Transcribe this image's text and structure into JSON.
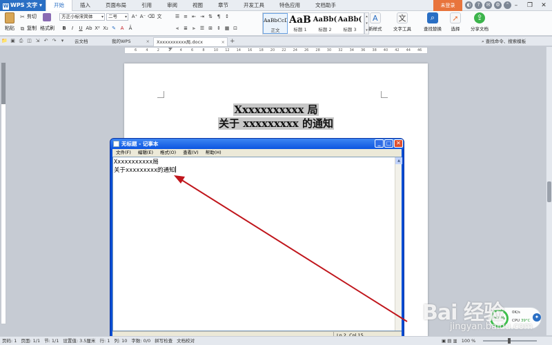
{
  "app": {
    "name": "WPS 文字"
  },
  "menu": [
    "开始",
    "插入",
    "页面布局",
    "引用",
    "审阅",
    "视图",
    "章节",
    "开发工具",
    "特色应用",
    "文档助手"
  ],
  "login_label": "未登录",
  "ribbon": {
    "paste": "粘贴",
    "cut": "剪切",
    "copy": "复制",
    "format_painter": "格式刷",
    "font_name": "方正小标宋简体",
    "font_size": "二号",
    "styles": [
      {
        "preview": "AaBbCcD",
        "name": "正文"
      },
      {
        "preview": "AaB",
        "name": "标题 1"
      },
      {
        "preview": "AaBb(",
        "name": "标题 2"
      },
      {
        "preview": "AaBb(",
        "name": "标题 3"
      }
    ],
    "new_style": "新样式",
    "text_tools": "文字工具",
    "find_replace": "查找替换",
    "select": "选择",
    "share_doc": "分享文档"
  },
  "tabs": [
    {
      "label": "云文档"
    },
    {
      "label": "我的WPS"
    },
    {
      "label": "Xxxxxxxxxxx局.docx"
    }
  ],
  "command_search": "查找命令、搜索模板",
  "ruler_ticks": [
    "6",
    "4",
    "2",
    "2",
    "4",
    "6",
    "8",
    "10",
    "12",
    "14",
    "16",
    "18",
    "20",
    "22",
    "24",
    "26",
    "28",
    "30",
    "32",
    "34",
    "36",
    "38",
    "40",
    "42",
    "44",
    "46"
  ],
  "document": {
    "line1": "Xxxxxxxxxxx 局",
    "line2": "关于 xxxxxxxxx 的通知"
  },
  "notepad": {
    "title": "无标题 - 记事本",
    "menu": [
      "文件(F)",
      "编辑(E)",
      "格式(O)",
      "查看(V)",
      "帮助(H)"
    ],
    "line1": "Xxxxxxxxxxx局",
    "line2": "关于xxxxxxxxx的通知",
    "status_pos": "Ln 2, Col 15"
  },
  "statusbar": {
    "items": [
      "页码: 1",
      "页面: 1/1",
      "节: 1/1",
      "设置值: 3.5厘米",
      "行: 1",
      "列: 10",
      "字数: 0/0",
      "拼写检查",
      "文档校对"
    ],
    "zoom": "100 %"
  },
  "cpu": {
    "percent": "52%",
    "speed": "0K/s",
    "label": "CPU",
    "temp": "39°C"
  },
  "watermark": {
    "logo": "Bai 经验",
    "url": "jingyan.baidu.com"
  },
  "colors": {
    "accent": "#2a6fc4",
    "login": "#e8743c",
    "arrow": "#c0161c",
    "xp_title": "#0c55e0"
  }
}
